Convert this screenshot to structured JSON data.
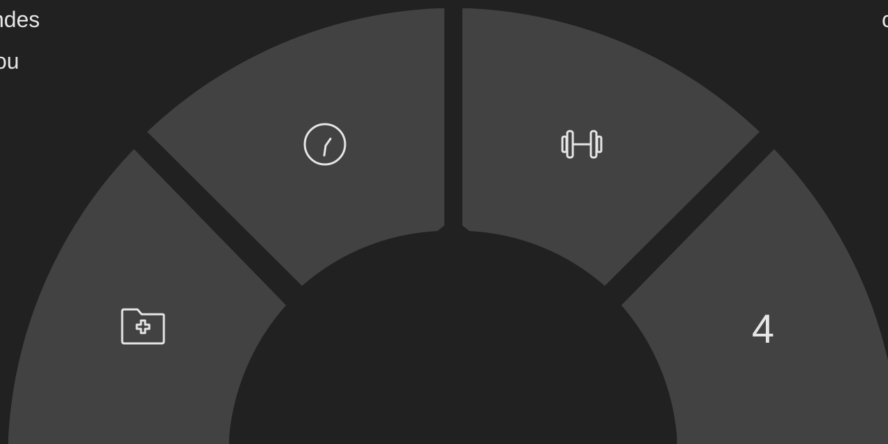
{
  "background_text": {
    "line1": "ndes",
    "line2": "ou",
    "right_fragment": "c"
  },
  "menu": {
    "items": [
      {
        "id": "new-folder",
        "icon": "folder-plus-icon"
      },
      {
        "id": "clock",
        "icon": "clock-icon"
      },
      {
        "id": "workout",
        "icon": "dumbbell-icon"
      },
      {
        "id": "count",
        "label": "4"
      }
    ]
  },
  "colors": {
    "background": "#212121",
    "segment": "#424242",
    "icon": "#e6e6e6"
  }
}
